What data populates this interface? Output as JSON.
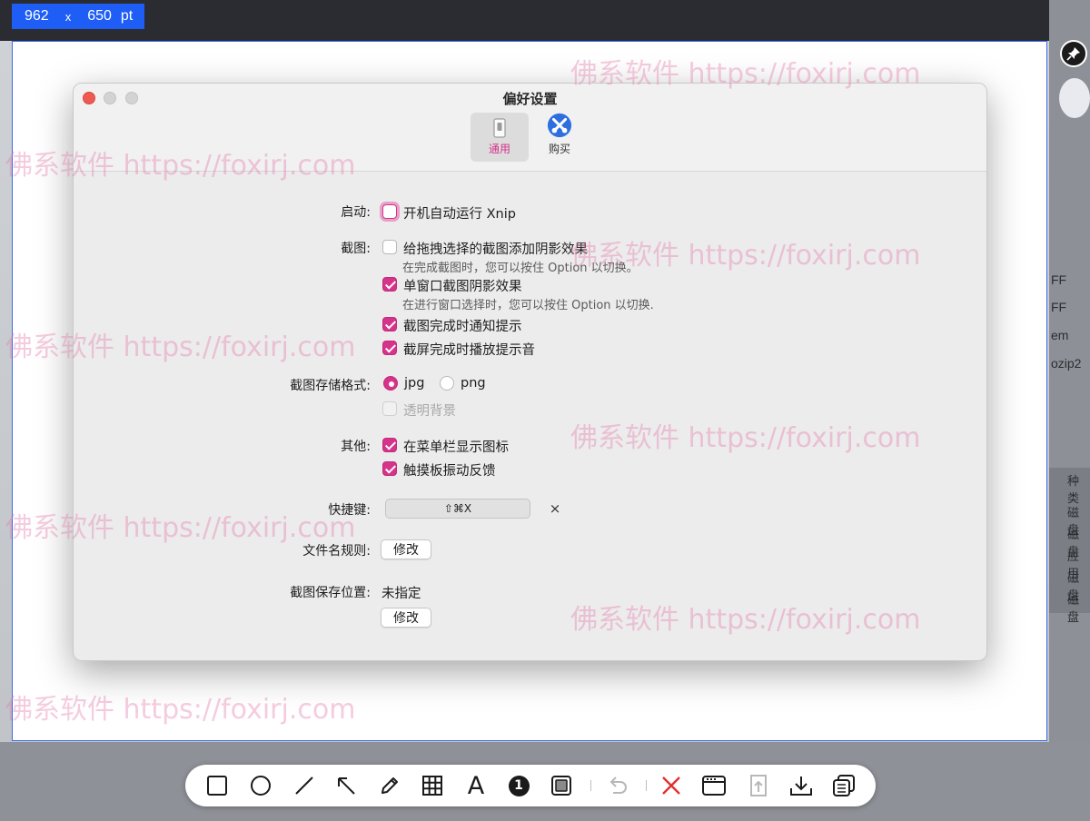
{
  "capture_size": {
    "width": "962",
    "sep": "x",
    "height": "650",
    "unit": "pt"
  },
  "window": {
    "title": "偏好设置"
  },
  "tabs": [
    {
      "label": "通用",
      "icon": "switch-icon",
      "selected": true
    },
    {
      "label": "购买",
      "icon": "xnip-logo-icon",
      "selected": false
    }
  ],
  "settings": {
    "startup": {
      "label": "启动:",
      "option": "开机自动运行 Xnip",
      "checked": false
    },
    "capture": {
      "label": "截图:",
      "drag_shadow": {
        "text": "给拖拽选择的截图添加阴影效果",
        "hint": "在完成截图时，您可以按住 Option 以切换。",
        "checked": false
      },
      "window_shadow": {
        "text": "单窗口截图阴影效果",
        "hint": "在进行窗口选择时，您可以按住 Option 以切换.",
        "checked": true
      },
      "notify": {
        "text": "截图完成时通知提示",
        "checked": true
      },
      "sound": {
        "text": "截屏完成时播放提示音",
        "checked": true
      }
    },
    "format": {
      "label": "截图存储格式:",
      "jpg": "jpg",
      "png": "png",
      "selected": "jpg",
      "transparent": "透明背景"
    },
    "other": {
      "label": "其他:",
      "menubar_icon": {
        "text": "在菜单栏显示图标",
        "checked": true
      },
      "haptic": {
        "text": "触摸板振动反馈",
        "checked": true
      }
    },
    "shortcut": {
      "label": "快捷键:",
      "value": "⇧⌘X",
      "clear": "×"
    },
    "filename": {
      "label": "文件名规则:",
      "button": "修改"
    },
    "save_location": {
      "label": "截图保存位置:",
      "value": "未指定",
      "button": "修改"
    }
  },
  "toolbar": {
    "tools": [
      "rectangle-tool-icon",
      "ellipse-tool-icon",
      "line-tool-icon",
      "arrow-tool-icon",
      "pencil-tool-icon",
      "mosaic-tool-icon",
      "text-tool-icon",
      "step-number-tool-icon",
      "highlight-tool-icon",
      "undo-icon",
      "cancel-icon",
      "pin-to-screen-icon",
      "share-icon",
      "download-icon",
      "copy-icon"
    ],
    "step_number": "1",
    "text_tool": "A"
  },
  "background_fragments": [
    "FF",
    "FF",
    "em",
    "ozip2",
    "种类",
    "磁盘",
    "磁盘",
    "应用",
    "磁盘",
    "磁盘"
  ],
  "watermark": "佛系软件 https://foxirj.com",
  "colors": {
    "accent": "#d6338a",
    "capture_border": "#3a6cf0",
    "size_label_bg": "#1e5ef6",
    "cancel_red": "#e03131"
  }
}
